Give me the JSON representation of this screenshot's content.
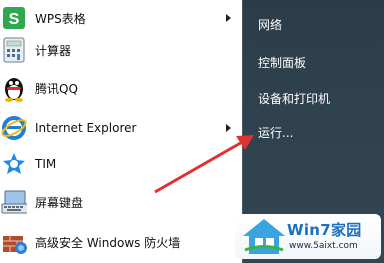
{
  "start_menu": {
    "programs": [
      {
        "label": "WPS表格",
        "icon": "wps-spreadsheet-icon",
        "has_submenu": true
      },
      {
        "label": "计算器",
        "icon": "calculator-icon",
        "has_submenu": false
      },
      {
        "label": "腾讯QQ",
        "icon": "qq-penguin-icon",
        "has_submenu": false
      },
      {
        "label": "Internet Explorer",
        "icon": "internet-explorer-icon",
        "has_submenu": true
      },
      {
        "label": "TIM",
        "icon": "tim-icon",
        "has_submenu": false
      },
      {
        "label": "屏幕键盘",
        "icon": "on-screen-keyboard-icon",
        "has_submenu": false
      },
      {
        "label": "高级安全 Windows 防火墙",
        "icon": "firewall-icon",
        "has_submenu": false
      }
    ],
    "right_links": [
      "网络",
      "控制面板",
      "设备和打印机",
      "运行..."
    ]
  },
  "annotation": {
    "color": "#e03030",
    "points_to": "运行..."
  },
  "watermark": {
    "title": "Win7家园",
    "url": "www.5aixt.com"
  },
  "colors": {
    "right_pane": "#30424f",
    "wps_green": "#2fa84f",
    "ie_blue": "#1e7fd6"
  }
}
